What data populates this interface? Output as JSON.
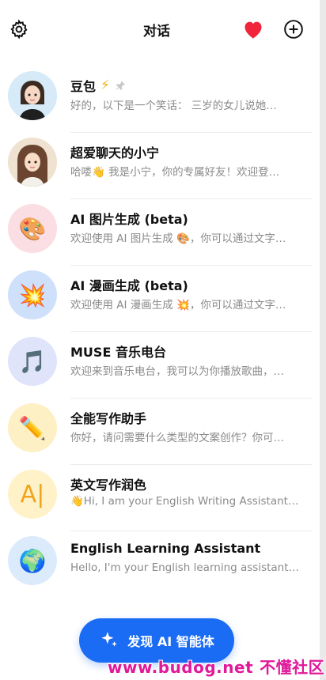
{
  "header": {
    "title": "对话",
    "settings_icon": "gear-icon",
    "favorite_icon": "heart-icon",
    "add_icon": "plus-circle-icon"
  },
  "conversations": [
    {
      "title": "豆包",
      "subtitle": "好的，以下是一个笑话： 三岁的女儿说她…",
      "avatar": "doubao-avatar",
      "badges": [
        "lightning-icon",
        "pin-icon"
      ]
    },
    {
      "title": "超爱聊天的小宁",
      "subtitle": "哈喽👋 我是小宁，你的专属好友！欢迎登…",
      "avatar": "xiaoning-avatar"
    },
    {
      "title": "AI 图片生成 (beta)",
      "subtitle": "欢迎使用 AI 图片生成 🎨，你可以通过文字…",
      "avatar": "🎨"
    },
    {
      "title": "AI 漫画生成 (beta)",
      "subtitle": "欢迎使用 AI 漫画生成 💥，你可以通过文字…",
      "avatar": "💥"
    },
    {
      "title": "MUSE 音乐电台",
      "subtitle": "欢迎来到音乐电台，我可以为你播放歌曲，…",
      "avatar": "🎵"
    },
    {
      "title": "全能写作助手",
      "subtitle": "你好，请问需要什么类型的文案创作？你可…",
      "avatar": "✏️"
    },
    {
      "title": "英文写作润色",
      "subtitle": "👋Hi, I am your English Writing Assistant…",
      "avatar": "A|"
    },
    {
      "title": "English Learning Assistant",
      "subtitle": "Hello, I'm your English learning assistant…",
      "avatar": "🌍"
    }
  ],
  "discover_button": {
    "label": "发现 AI 智能体",
    "icon": "sparkle-icon"
  },
  "watermark": {
    "text1": "www.budog.net",
    "text2": "不懂社区"
  },
  "colors": {
    "accent": "#1a6cf5",
    "heart": "#f0243a",
    "watermark": "#e0189a"
  }
}
